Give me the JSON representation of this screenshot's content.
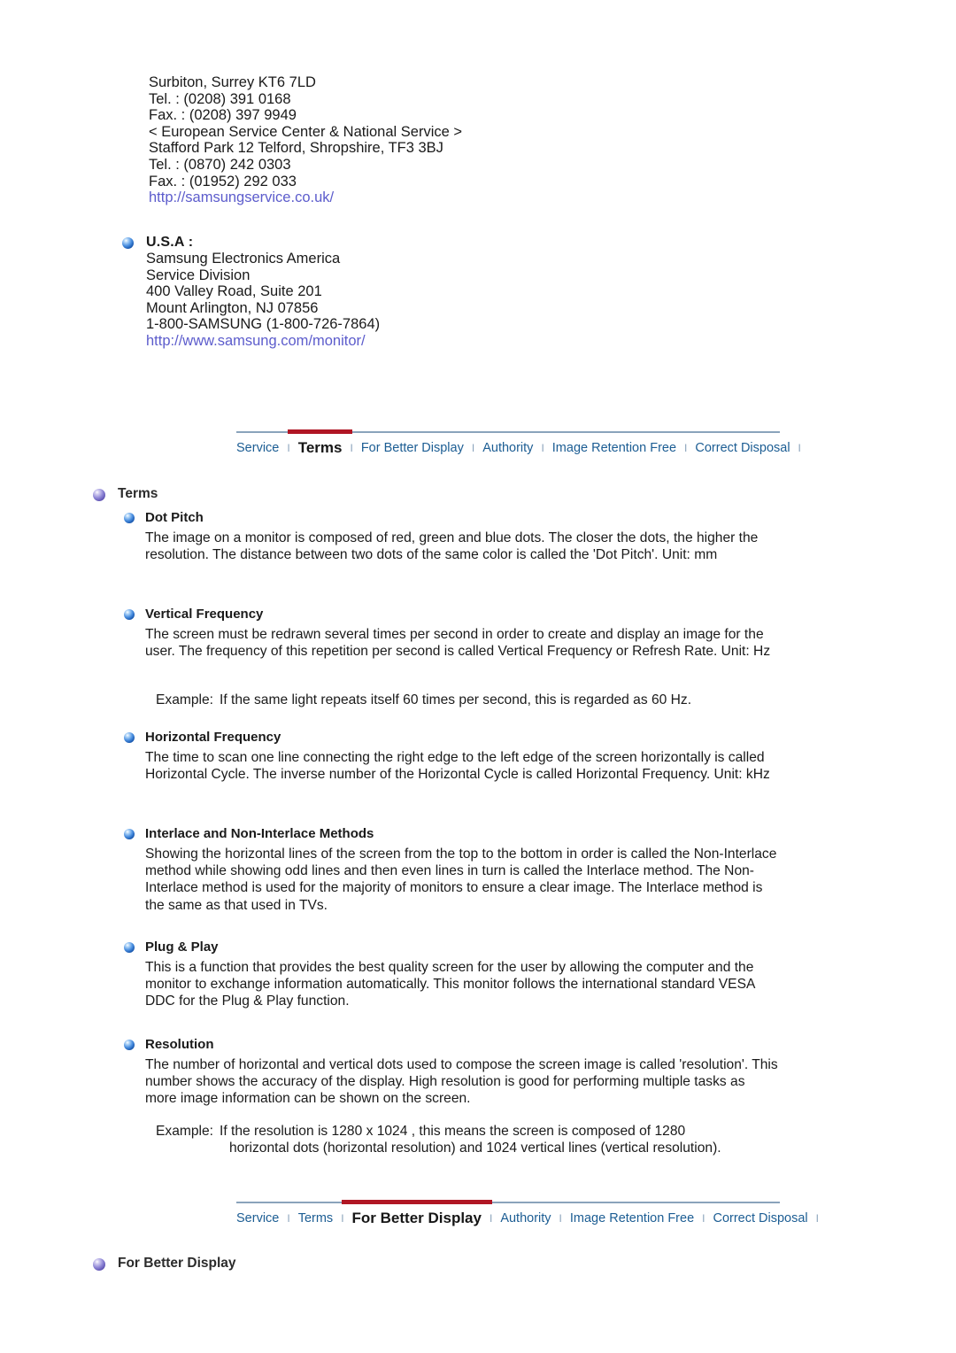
{
  "contact": {
    "uk_lines": [
      "Surbiton, Surrey KT6 7LD",
      "Tel. : (0208) 391 0168",
      "Fax. : (0208) 397 9949",
      "< European Service Center & National Service >",
      "Stafford Park 12 Telford, Shropshire, TF3 3BJ",
      "Tel. : (0870) 242 0303",
      "Fax. : (01952) 292 033"
    ],
    "uk_url": "http://samsungservice.co.uk/",
    "usa": {
      "title": "U.S.A :",
      "lines": [
        "Samsung Electronics America",
        "Service Division",
        "400 Valley Road, Suite 201",
        "Mount Arlington, NJ 07856",
        "1-800-SAMSUNG (1-800-726-7864)"
      ],
      "url": "http://www.samsung.com/monitor/"
    }
  },
  "nav_top": {
    "active": "Terms",
    "items": [
      "Service",
      "Terms",
      "For Better Display",
      "Authority",
      "Image Retention Free",
      "Correct Disposal"
    ]
  },
  "nav_bottom": {
    "active": "For Better Display",
    "items": [
      "Service",
      "Terms",
      "For Better Display",
      "Authority",
      "Image Retention Free",
      "Correct Disposal"
    ]
  },
  "terms_section": {
    "heading": "Terms",
    "entries": [
      {
        "title": "Dot Pitch",
        "body": "The image on a monitor is composed of red, green and blue dots. The closer the dots, the higher the resolution. The distance between two dots of the same color is called the 'Dot Pitch'. Unit: mm"
      },
      {
        "title": "Vertical Frequency",
        "body": "The screen must be redrawn several times per second in order to create and display an image for the user. The frequency of this repetition per second is called Vertical Frequency or Refresh Rate. Unit: Hz"
      },
      {
        "title": "Horizontal Frequency",
        "body": "The time to scan one line connecting the right edge to the left edge of the screen horizontally is called Horizontal Cycle. The inverse number of the Horizontal Cycle is called Horizontal Frequency. Unit: kHz"
      },
      {
        "title": "Interlace and Non-Interlace Methods",
        "body": "Showing the horizontal lines of the screen from the top to the bottom in order is called the Non-Interlace method while showing odd lines and then even lines in turn is called the Interlace method. The Non-Interlace method is used for the majority of monitors to ensure a clear image. The Interlace method is the same as that used in TVs."
      },
      {
        "title": "Plug & Play",
        "body": "This is a function that provides the best quality screen for the user by allowing the computer and the monitor to exchange information automatically. This monitor follows the international standard VESA DDC for the Plug & Play function."
      },
      {
        "title": "Resolution",
        "body": "The number of horizontal and vertical dots used to compose the screen image is called 'resolution'. This number shows the accuracy of the display. High resolution is good for performing multiple tasks as more image information can be shown on the screen."
      }
    ],
    "example_vertical_label": "Example:",
    "example_vertical_text": "If the same light repeats itself 60 times per second, this is regarded as 60 Hz.",
    "example_resolution_label": "Example:",
    "example_resolution_line1": "If the resolution is 1280 x 1024 , this means the screen is composed of 1280",
    "example_resolution_line2": "horizontal dots (horizontal resolution) and 1024 vertical lines (vertical resolution)."
  },
  "better_display_section": {
    "heading": "For Better Display"
  },
  "colors": {
    "link": "#5c5ccc",
    "nav_link": "#1c5d93",
    "nav_active_mark": "#b01624",
    "nav_rule": "#8aa3bb",
    "text": "#1a1a1a",
    "bullet_blue": "#1250a8",
    "bullet_purple": "#5b4fb0"
  }
}
